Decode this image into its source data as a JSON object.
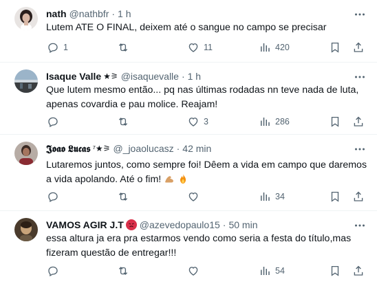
{
  "tweets": [
    {
      "name": "nath",
      "handle": "@nathbfr",
      "time": "1 h",
      "text_lines": [
        "Lutem ATE O FINAL, deixem até o sangue no campo se precisar"
      ],
      "counts": {
        "replies": "1",
        "retweets": "",
        "likes": "11",
        "views": "420"
      }
    },
    {
      "name": "Isaque Valle",
      "name_deco": "★⚞",
      "handle": "@isaquevalle",
      "time": "1 h",
      "text_lines": [
        "Que lutem mesmo então... pq nas últimas rodadas nn teve nada de luta,",
        "apenas covardia e pau molice. Reajam!"
      ],
      "counts": {
        "replies": "",
        "retweets": "",
        "likes": "3",
        "views": "286"
      }
    },
    {
      "name": "𝕵𝖔𝖆𝖔 𝕷𝖚𝖈𝖆𝖘",
      "name_deco": "⁷★⚞",
      "handle": "@_joaolucasz",
      "time": "42 min",
      "text_lines": [
        "Lutaremos juntos, como sempre foi! Dêem a vida em campo que daremos",
        "a vida apolando. Até o fim!"
      ],
      "counts": {
        "replies": "",
        "retweets": "",
        "likes": "",
        "views": "34"
      }
    },
    {
      "name": "VAMOS AGIR J.T",
      "handle": "@azevedopaulo15",
      "time": "50 min",
      "text_lines": [
        "essa altura ja era pra estarmos vendo como seria a festa do título,mas",
        "fizeram questão de entregar!!!"
      ],
      "counts": {
        "replies": "",
        "retweets": "",
        "likes": "",
        "views": "54"
      }
    }
  ],
  "separator": "·",
  "icons": [
    "reply-icon",
    "retweet-icon",
    "like-icon",
    "views-icon",
    "bookmark-icon",
    "share-icon",
    "more-icon"
  ],
  "colors": {
    "text": "#0f1419",
    "muted": "#536471",
    "divider": "#eff3f4"
  }
}
